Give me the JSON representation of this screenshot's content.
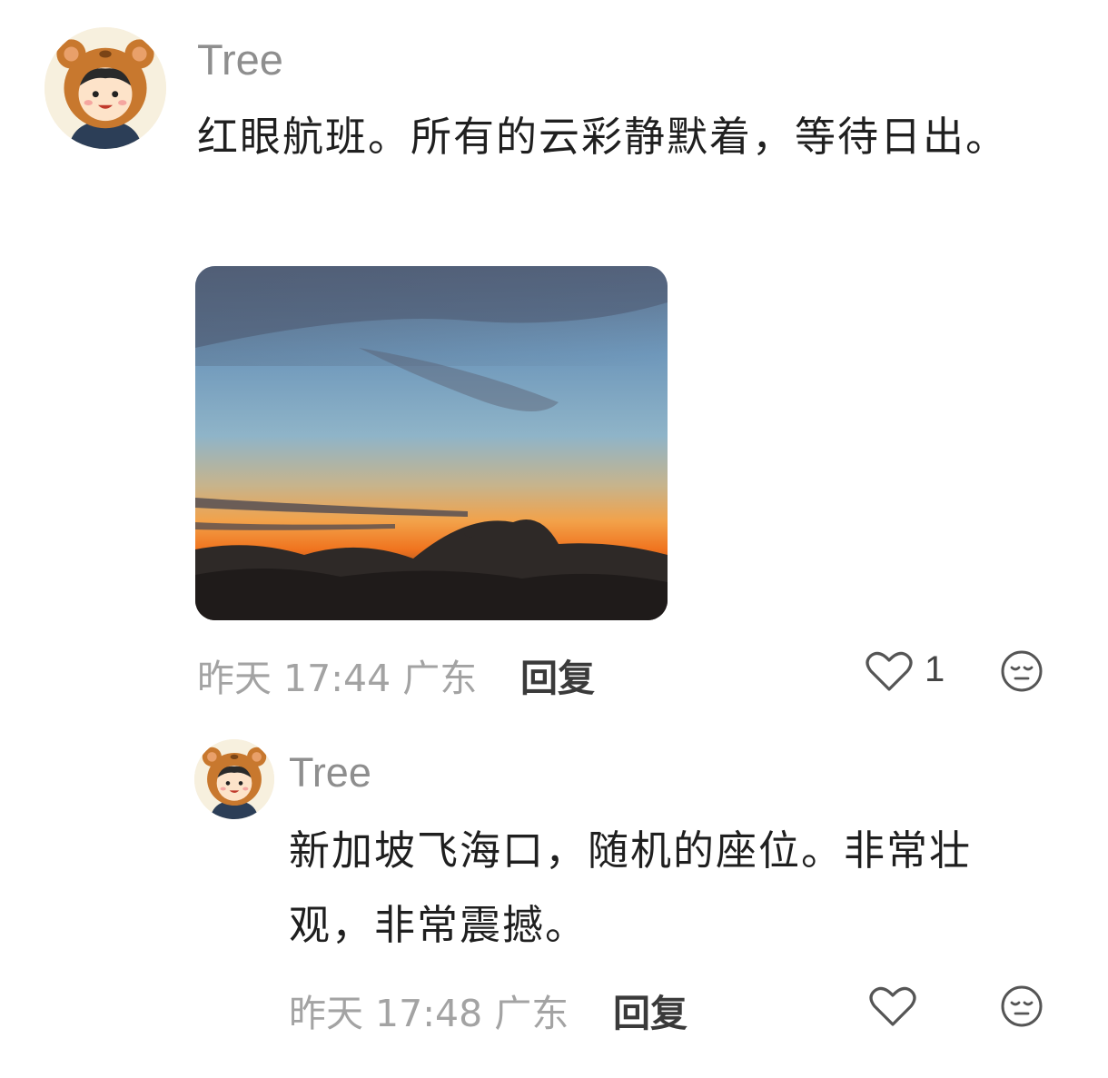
{
  "comment": {
    "author": "Tree",
    "text": "红眼航班。所有的云彩静默着，等待日出。",
    "image_icon": "sunset-above-clouds-photo",
    "time": "昨天 17:44 广东",
    "reply_label": "回复",
    "like_count": "1",
    "like_icon": "heart-icon",
    "react_icon": "emoji-face-icon"
  },
  "reply": {
    "author": "Tree",
    "text": "新加坡飞海口，随机的座位。非常壮观，非常震撼。",
    "time": "昨天 17:48 广东",
    "reply_label": "回复",
    "like_icon": "heart-icon",
    "react_icon": "emoji-face-icon"
  },
  "colors": {
    "avatar_bear": "#c8782e",
    "sky_top": "#5c6f8a",
    "horizon": "#f0741f"
  }
}
